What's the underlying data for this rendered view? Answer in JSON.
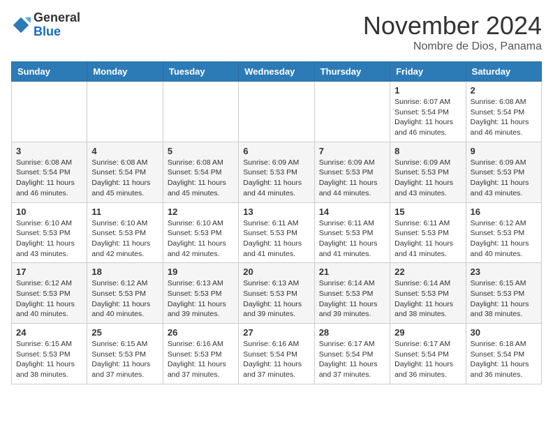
{
  "logo": {
    "general": "General",
    "blue": "Blue"
  },
  "header": {
    "month": "November 2024",
    "location": "Nombre de Dios, Panama"
  },
  "weekdays": [
    "Sunday",
    "Monday",
    "Tuesday",
    "Wednesday",
    "Thursday",
    "Friday",
    "Saturday"
  ],
  "weeks": [
    [
      {
        "day": "",
        "info": ""
      },
      {
        "day": "",
        "info": ""
      },
      {
        "day": "",
        "info": ""
      },
      {
        "day": "",
        "info": ""
      },
      {
        "day": "",
        "info": ""
      },
      {
        "day": "1",
        "info": "Sunrise: 6:07 AM\nSunset: 5:54 PM\nDaylight: 11 hours\nand 46 minutes."
      },
      {
        "day": "2",
        "info": "Sunrise: 6:08 AM\nSunset: 5:54 PM\nDaylight: 11 hours\nand 46 minutes."
      }
    ],
    [
      {
        "day": "3",
        "info": "Sunrise: 6:08 AM\nSunset: 5:54 PM\nDaylight: 11 hours\nand 46 minutes."
      },
      {
        "day": "4",
        "info": "Sunrise: 6:08 AM\nSunset: 5:54 PM\nDaylight: 11 hours\nand 45 minutes."
      },
      {
        "day": "5",
        "info": "Sunrise: 6:08 AM\nSunset: 5:54 PM\nDaylight: 11 hours\nand 45 minutes."
      },
      {
        "day": "6",
        "info": "Sunrise: 6:09 AM\nSunset: 5:53 PM\nDaylight: 11 hours\nand 44 minutes."
      },
      {
        "day": "7",
        "info": "Sunrise: 6:09 AM\nSunset: 5:53 PM\nDaylight: 11 hours\nand 44 minutes."
      },
      {
        "day": "8",
        "info": "Sunrise: 6:09 AM\nSunset: 5:53 PM\nDaylight: 11 hours\nand 43 minutes."
      },
      {
        "day": "9",
        "info": "Sunrise: 6:09 AM\nSunset: 5:53 PM\nDaylight: 11 hours\nand 43 minutes."
      }
    ],
    [
      {
        "day": "10",
        "info": "Sunrise: 6:10 AM\nSunset: 5:53 PM\nDaylight: 11 hours\nand 43 minutes."
      },
      {
        "day": "11",
        "info": "Sunrise: 6:10 AM\nSunset: 5:53 PM\nDaylight: 11 hours\nand 42 minutes."
      },
      {
        "day": "12",
        "info": "Sunrise: 6:10 AM\nSunset: 5:53 PM\nDaylight: 11 hours\nand 42 minutes."
      },
      {
        "day": "13",
        "info": "Sunrise: 6:11 AM\nSunset: 5:53 PM\nDaylight: 11 hours\nand 41 minutes."
      },
      {
        "day": "14",
        "info": "Sunrise: 6:11 AM\nSunset: 5:53 PM\nDaylight: 11 hours\nand 41 minutes."
      },
      {
        "day": "15",
        "info": "Sunrise: 6:11 AM\nSunset: 5:53 PM\nDaylight: 11 hours\nand 41 minutes."
      },
      {
        "day": "16",
        "info": "Sunrise: 6:12 AM\nSunset: 5:53 PM\nDaylight: 11 hours\nand 40 minutes."
      }
    ],
    [
      {
        "day": "17",
        "info": "Sunrise: 6:12 AM\nSunset: 5:53 PM\nDaylight: 11 hours\nand 40 minutes."
      },
      {
        "day": "18",
        "info": "Sunrise: 6:12 AM\nSunset: 5:53 PM\nDaylight: 11 hours\nand 40 minutes."
      },
      {
        "day": "19",
        "info": "Sunrise: 6:13 AM\nSunset: 5:53 PM\nDaylight: 11 hours\nand 39 minutes."
      },
      {
        "day": "20",
        "info": "Sunrise: 6:13 AM\nSunset: 5:53 PM\nDaylight: 11 hours\nand 39 minutes."
      },
      {
        "day": "21",
        "info": "Sunrise: 6:14 AM\nSunset: 5:53 PM\nDaylight: 11 hours\nand 39 minutes."
      },
      {
        "day": "22",
        "info": "Sunrise: 6:14 AM\nSunset: 5:53 PM\nDaylight: 11 hours\nand 38 minutes."
      },
      {
        "day": "23",
        "info": "Sunrise: 6:15 AM\nSunset: 5:53 PM\nDaylight: 11 hours\nand 38 minutes."
      }
    ],
    [
      {
        "day": "24",
        "info": "Sunrise: 6:15 AM\nSunset: 5:53 PM\nDaylight: 11 hours\nand 38 minutes."
      },
      {
        "day": "25",
        "info": "Sunrise: 6:15 AM\nSunset: 5:53 PM\nDaylight: 11 hours\nand 37 minutes."
      },
      {
        "day": "26",
        "info": "Sunrise: 6:16 AM\nSunset: 5:53 PM\nDaylight: 11 hours\nand 37 minutes."
      },
      {
        "day": "27",
        "info": "Sunrise: 6:16 AM\nSunset: 5:54 PM\nDaylight: 11 hours\nand 37 minutes."
      },
      {
        "day": "28",
        "info": "Sunrise: 6:17 AM\nSunset: 5:54 PM\nDaylight: 11 hours\nand 37 minutes."
      },
      {
        "day": "29",
        "info": "Sunrise: 6:17 AM\nSunset: 5:54 PM\nDaylight: 11 hours\nand 36 minutes."
      },
      {
        "day": "30",
        "info": "Sunrise: 6:18 AM\nSunset: 5:54 PM\nDaylight: 11 hours\nand 36 minutes."
      }
    ]
  ]
}
